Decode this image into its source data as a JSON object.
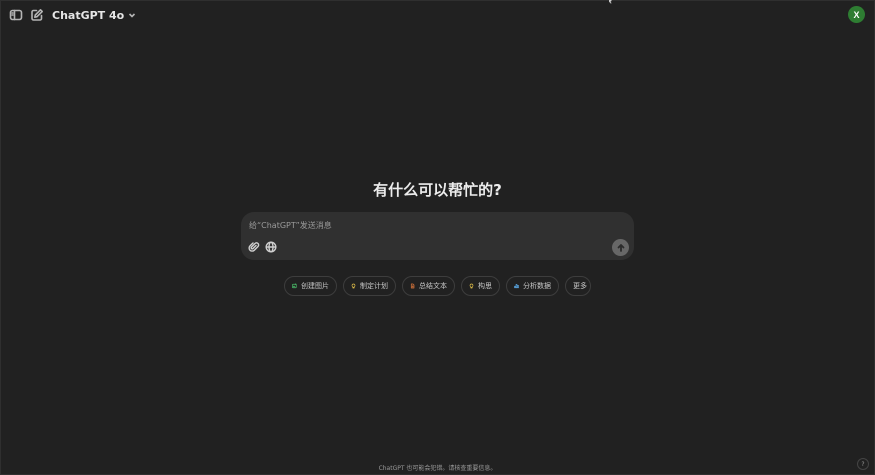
{
  "topbar": {
    "model_name": "ChatGPT 4o",
    "avatar_initial": "X",
    "icons": [
      "sidebar-toggle-icon",
      "new-chat-icon",
      "chevron-down-icon"
    ]
  },
  "main": {
    "heading": "有什么可以帮忙的?"
  },
  "composer": {
    "placeholder": "给“ChatGPT”发送消息",
    "value": "",
    "icons": [
      "paperclip-icon",
      "globe-icon",
      "arrow-up-icon"
    ]
  },
  "chips": [
    {
      "label": "创建图片",
      "icon": "image-create-icon",
      "color": "#4bbf6b"
    },
    {
      "label": "制定计划",
      "icon": "lightbulb-icon",
      "color": "#e6c34a"
    },
    {
      "label": "总结文本",
      "icon": "document-icon",
      "color": "#e0783c"
    },
    {
      "label": "构思",
      "icon": "lightbulb-icon",
      "color": "#e6c34a"
    },
    {
      "label": "分析数据",
      "icon": "chart-icon",
      "color": "#5aa9e6"
    },
    {
      "label": "更多",
      "icon": "",
      "color": ""
    }
  ],
  "footer": {
    "disclaimer": "ChatGPT 也可能会犯错。请核查重要信息。",
    "help_label": "?"
  },
  "colors": {
    "background": "#212121",
    "composer": "#303030",
    "avatar": "#2e7d32"
  }
}
